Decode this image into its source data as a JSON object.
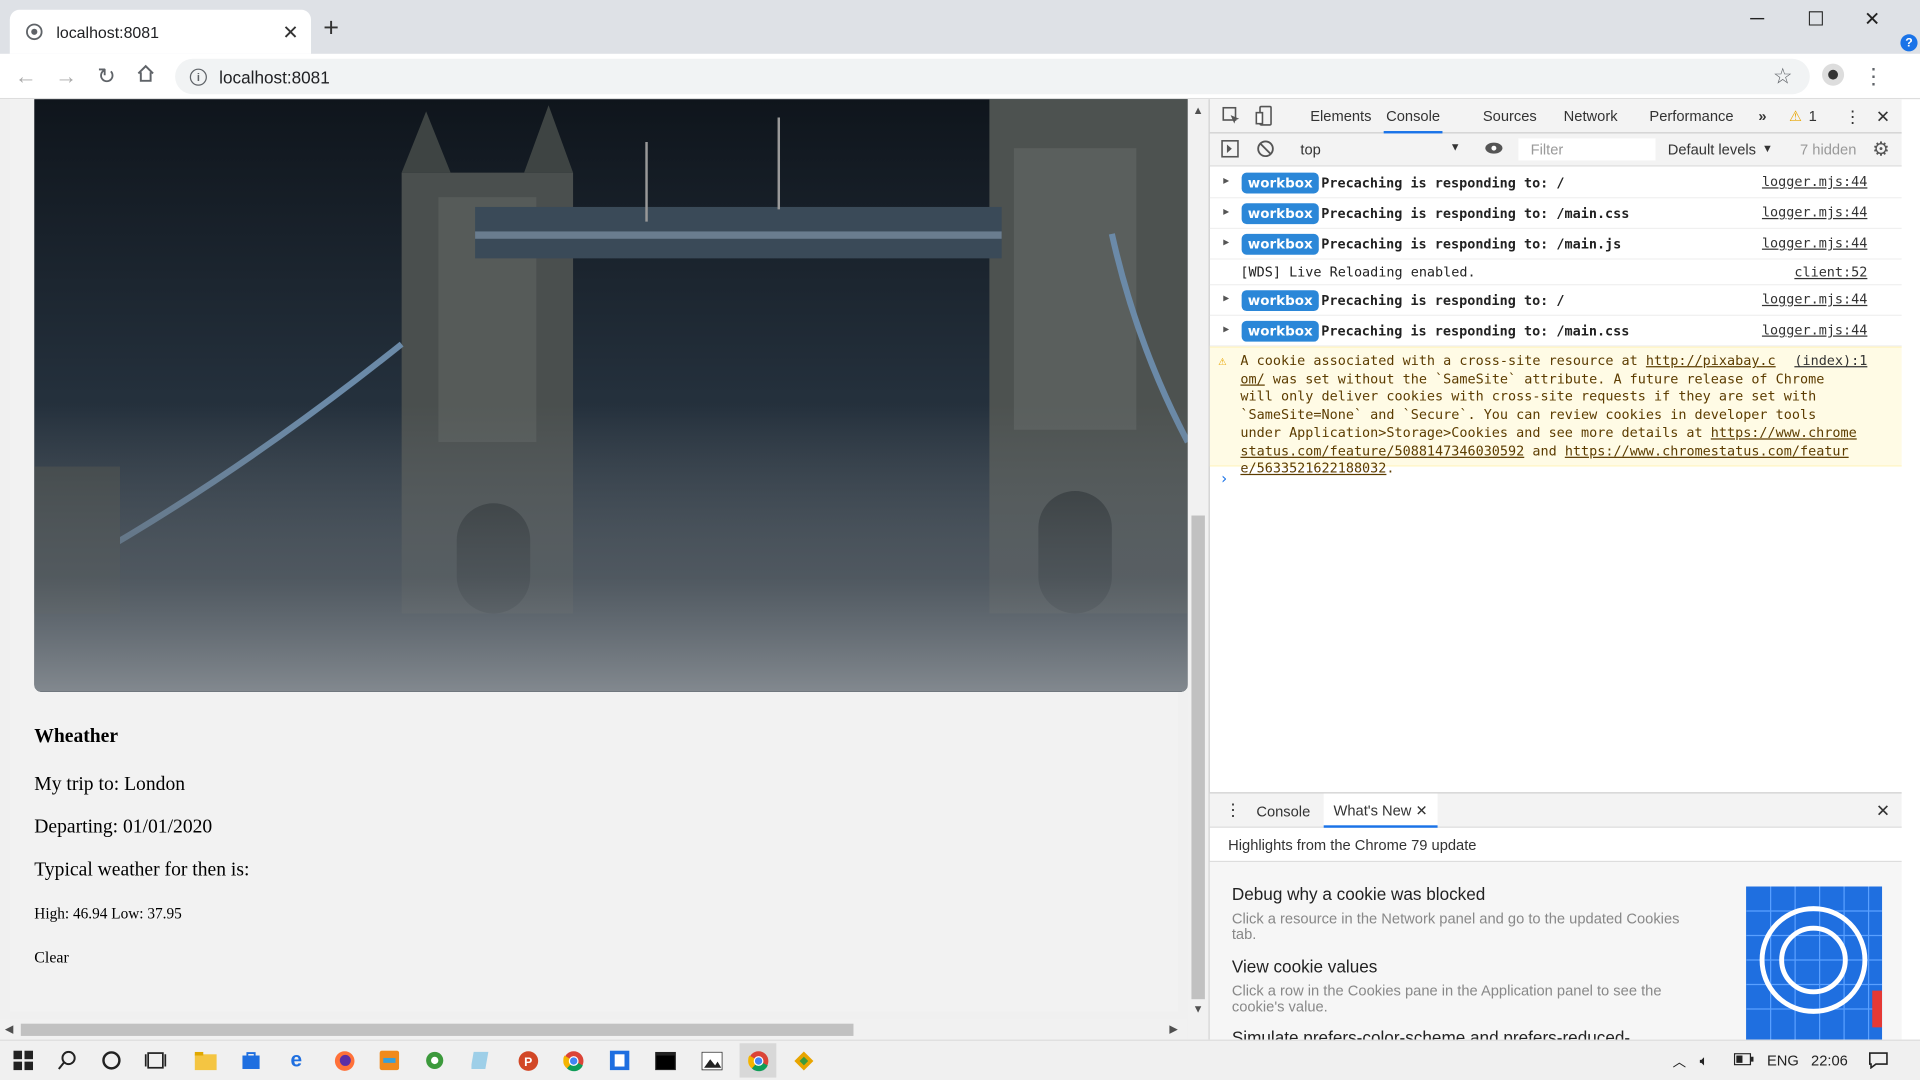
{
  "browser": {
    "tab_title": "localhost:8081",
    "url": "localhost:8081"
  },
  "page": {
    "heading": "Wheather",
    "trip": "My trip to: London",
    "departing": "Departing: 01/01/2020",
    "typical": "Typical weather for then is:",
    "temps": "High: 46.94 Low: 37.95",
    "clear": "Clear"
  },
  "devtools": {
    "tabs": [
      "Elements",
      "Console",
      "Sources",
      "Network",
      "Performance"
    ],
    "active_tab": "Console",
    "warnings_count": "1",
    "context": "top",
    "filter_placeholder": "Filter",
    "levels": "Default levels",
    "hidden": "7 hidden",
    "logs": [
      {
        "badge": "workbox",
        "msg": "Precaching is responding to: /",
        "src": "logger.mjs:44"
      },
      {
        "badge": "workbox",
        "msg": "Precaching is responding to: /main.css",
        "src": "logger.mjs:44"
      },
      {
        "badge": "workbox",
        "msg": "Precaching is responding to: /main.js",
        "src": "logger.mjs:44"
      },
      {
        "badge": "",
        "msg": "[WDS] Live Reloading enabled.",
        "src": "client:52"
      },
      {
        "badge": "workbox",
        "msg": "Precaching is responding to: /",
        "src": "logger.mjs:44"
      },
      {
        "badge": "workbox",
        "msg": "Precaching is responding to: /main.css",
        "src": "logger.mjs:44"
      }
    ],
    "warning": {
      "src": "(index):1",
      "line1": "A cookie associated with a cross-site resource at ",
      "link1": "http://pixabay.c",
      "line2_link": "om/",
      "line2": " was set without the `SameSite` attribute. A future release of Chrome",
      "line3": "will only deliver cookies with cross-site requests if they are set with",
      "line4": "`SameSite=None` and `Secure`. You can review cookies in developer tools",
      "line5": "under Application>Storage>Cookies and see more details at ",
      "link2a": "https://www.chrome",
      "link2b": "status.com/feature/5088147346030592",
      "and": " and ",
      "link3a": "https://www.chromestatus.com/featur",
      "link3b": "e/5633521622188032",
      "end": "."
    },
    "drawer": {
      "tab_console": "Console",
      "tab_whatsnew": "What's New",
      "subtitle": "Highlights from the Chrome 79 update",
      "items": [
        {
          "title": "Debug why a cookie was blocked",
          "desc": "Click a resource in the Network panel and go to the updated Cookies tab."
        },
        {
          "title": "View cookie values",
          "desc": "Click a row in the Cookies pane in the Application panel to see the cookie's value."
        },
        {
          "title": "Simulate prefers-color-scheme and prefers-reduced-",
          "desc": ""
        }
      ]
    }
  },
  "taskbar": {
    "lang": "ENG",
    "time": "22:06"
  },
  "colors": {
    "accent": "#1a73e8",
    "workbox_badge": "#2b87d8",
    "warning_bg": "#fffbe5"
  }
}
